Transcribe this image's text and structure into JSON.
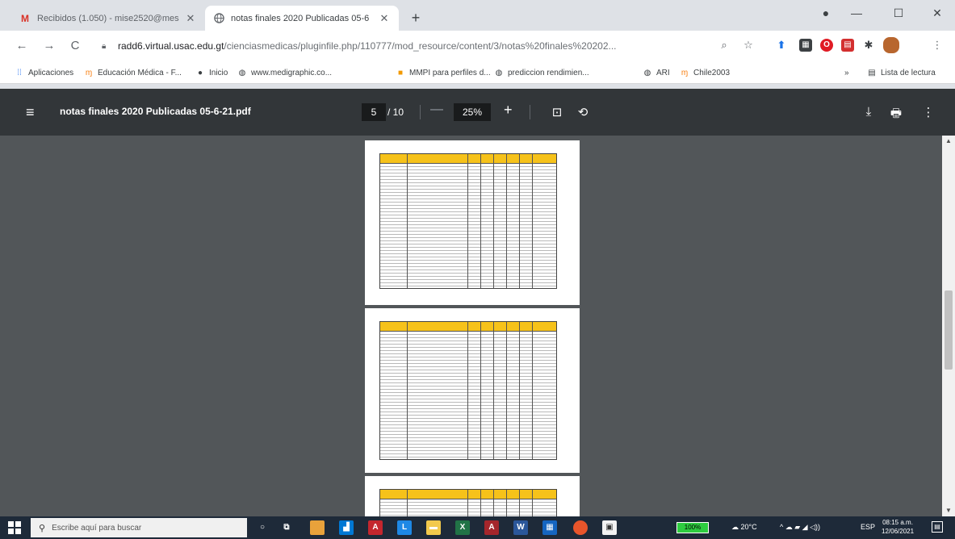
{
  "tabs": [
    {
      "icon": "gmail-icon",
      "title": "Recibidos (1.050) - mise2520@mes",
      "close": "✕"
    },
    {
      "icon": "globe-icon",
      "title": "notas finales 2020 Publicadas 05-6",
      "close": "✕"
    }
  ],
  "new_tab": "+",
  "window_controls": {
    "minimize": "—",
    "maximize": "☐",
    "close": "✕"
  },
  "nav": {
    "back": "←",
    "forward": "→",
    "reload": "C"
  },
  "omnibox": {
    "host": "radd6.virtual.usac.edu.gt",
    "path": "/cienciasmedicas/pluginfile.php/110777/mod_resource/content/3/notas%20finales%20202..."
  },
  "bookmarks": [
    {
      "icon": "apps-icon",
      "label": "Aplicaciones"
    },
    {
      "icon": "moodle-icon",
      "label": "Educación Médica - F..."
    },
    {
      "icon": "home-icon",
      "label": "Inicio"
    },
    {
      "icon": "globe-icon",
      "label": "www.medigraphic.co..."
    },
    {
      "icon": "bookmark-icon",
      "label": "MMPI para perfiles d..."
    },
    {
      "icon": "globe-icon",
      "label": "prediccion rendimien..."
    },
    {
      "icon": "globe-icon",
      "label": "ARI"
    },
    {
      "icon": "moodle-icon",
      "label": "Chile2003"
    }
  ],
  "reading_list": "Lista de lectura",
  "pdf": {
    "title": "notas finales 2020 Publicadas 05-6-21.pdf",
    "current_page": "5",
    "total_pages": "/ 10",
    "zoom": "25%",
    "zoom_minus": "—",
    "zoom_plus": "+"
  },
  "taskbar": {
    "search_placeholder": "Escribe aquí para buscar",
    "battery": "100%",
    "weather": "20°C",
    "language": "ESP",
    "time": "08:15 a.m.",
    "date": "12/06/2021"
  },
  "colors": {
    "pdf_toolbar": "#323639",
    "viewer_bg": "#525659",
    "table_header": "#f6c21a",
    "taskbar": "#1e2a39"
  }
}
